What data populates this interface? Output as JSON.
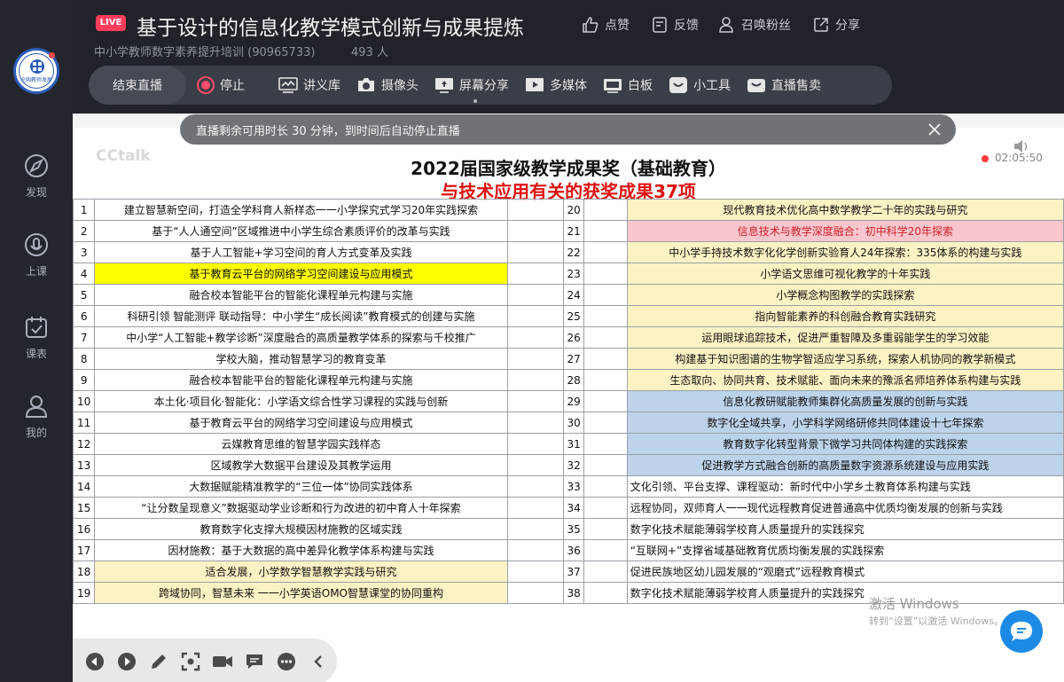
{
  "header": {
    "live_badge": "LIVE",
    "title": "基于设计的信息化教学模式创新与成果提炼",
    "subtitle": "中小学教师数字素养提升培训 (90965733)",
    "viewers": "493 人",
    "actions": {
      "like": "点赞",
      "feedback": "反馈",
      "summon": "召唤粉丝",
      "share": "分享"
    }
  },
  "logo": {
    "text": "全国教师发展"
  },
  "sidebar": {
    "items": [
      {
        "label": "发现",
        "icon": "compass-icon"
      },
      {
        "label": "上课",
        "icon": "microphone-icon"
      },
      {
        "label": "课表",
        "icon": "calendar-check-icon"
      },
      {
        "label": "我的",
        "icon": "user-icon"
      }
    ]
  },
  "toolbar": {
    "end_live": "结束直播",
    "stop": "停止",
    "lecture_library": "讲义库",
    "camera": "摄像头",
    "screen_share": "屏幕分享",
    "multimedia": "多媒体",
    "whiteboard": "白板",
    "tools": "小工具",
    "live_sales": "直播售卖"
  },
  "notice": {
    "text": "直播剩余可用时长 30 分钟，到时间后自动停止直播"
  },
  "recording": {
    "time": "02:05:50"
  },
  "slide": {
    "watermark": "CCtalk",
    "title": "2022届国家级教学成果奖（基础教育）",
    "subtitle": "与技术应用有关的获奖成果37项",
    "rows": [
      {
        "n1": "1",
        "left": "建立智慧新空间，打造全学科育人新样态一一小学探究式学习20年实践探索",
        "n2": "20",
        "right": "现代教育技术优化高中数学教学二十年的实践与研究"
      },
      {
        "n1": "2",
        "left": "基于“人人通空间”区域推进中小学生综合素质评价的改革与实践",
        "n2": "21",
        "right": "信息技术与教学深度融合：初中科学20年探索"
      },
      {
        "n1": "3",
        "left": "基于人工智能+学习空间的育人方式变革及实践",
        "n2": "22",
        "right": "中小学手持技术数字化化学创新实验育人24年探索：335体系的构建与实践"
      },
      {
        "n1": "4",
        "left": "基于教育云平台的网络学习空间建设与应用模式",
        "n2": "23",
        "right": "小学语文思维可视化教学的十年实践"
      },
      {
        "n1": "5",
        "left": "融合校本智能平台的智能化课程单元构建与实施",
        "n2": "24",
        "right": "小学概念构图教学的实践探索"
      },
      {
        "n1": "6",
        "left": "科研引领  智能测评  联动指导：中小学生“成长阅读”教育模式的创建与实施",
        "n2": "25",
        "right": "指向智能素养的科创融合教育实践研究"
      },
      {
        "n1": "7",
        "left": "中小学“人工智能+教学诊断”深度融合的高质量教学体系的探索与千校推广",
        "n2": "26",
        "right": "运用眼球追踪技术，促进严重智障及多重弱能学生的学习效能"
      },
      {
        "n1": "8",
        "left": "学校大脑，推动智慧学习的教育变革",
        "n2": "27",
        "right": "构建基于知识图谱的生物学智适应学习系统，探索人机协同的教学新模式"
      },
      {
        "n1": "9",
        "left": "融合校本智能平台的智能化课程单元构建与实施",
        "n2": "28",
        "right": "生态取向、协同共育、技术赋能、面向未来的豫派名师培养体系构建与实践"
      },
      {
        "n1": "10",
        "left": "本土化·项目化·智能化：小学语文综合性学习课程的实践与创新",
        "n2": "29",
        "right": "信息化教研赋能教师集群化高质量发展的创新与实践"
      },
      {
        "n1": "11",
        "left": "基于教育云平台的网络学习空间建设与应用模式",
        "n2": "30",
        "right": "数字化全域共享，小学科学网络研修共同体建设十七年探索"
      },
      {
        "n1": "12",
        "left": "云媒教育思维的智慧学园实践样态",
        "n2": "31",
        "right": "教育数字化转型背景下微学习共同体构建的实践探索"
      },
      {
        "n1": "13",
        "left": "区域教学大数据平台建设及其教学运用",
        "n2": "32",
        "right": "促进教学方式融合创新的高质量数字资源系统建设与应用实践"
      },
      {
        "n1": "14",
        "left": "大数据赋能精准教学的“三位一体”协同实践体系",
        "n2": "33",
        "right": "文化引领、平台支撑、课程驱动：新时代中小学乡土教育体系构建与实践"
      },
      {
        "n1": "15",
        "left": "“让分数呈现意义”数据驱动学业诊断和行为改进的初中育人十年探索",
        "n2": "34",
        "right": "远程协同，双师育人一一现代远程教育促进普通高中优质均衡发展的创新与实践"
      },
      {
        "n1": "16",
        "left": "教育数字化支撑大规模因材施教的区域实践",
        "n2": "35",
        "right": "数字化技术赋能薄弱学校育人质量提升的实践探究"
      },
      {
        "n1": "17",
        "left": "因材施教：基于大数据的高中差异化教学体系构建与实践",
        "n2": "36",
        "right": "“互联网+”支撑省域基础教育优质均衡发展的实践探索"
      },
      {
        "n1": "18",
        "left": "适合发展，小学数学智慧教学实践与研究",
        "n2": "37",
        "right": "促进民族地区幼儿园发展的“观磨式”远程教育模式"
      },
      {
        "n1": "19",
        "left": "跨域协同，智慧未来  一一小学英语OMO智慧课堂的协同重构",
        "n2": "38",
        "right": "数字化技术赋能薄弱学校育人质量提升的实践探究"
      }
    ],
    "left_highlights": {
      "4": "#ffff00",
      "18": "#fdf2c4",
      "19": "#fdf2c4"
    },
    "right_highlights": {
      "20": "#fdf2c4",
      "21": "#f8c6cc",
      "22": "#fdf2c4",
      "23": "#fdf2c4",
      "24": "#fdf2c4",
      "25": "#fdf2c4",
      "26": "#fdf2c4",
      "27": "#fdf2c4",
      "28": "#fdf2c4",
      "29": "#bcd3ea",
      "30": "#bcd3ea",
      "31": "#bcd3ea",
      "32": "#bcd3ea"
    },
    "right_text_colors": {
      "21": "#d0202a"
    },
    "right_centered": [
      "20",
      "21",
      "22",
      "23",
      "24",
      "25",
      "26",
      "27",
      "28",
      "29",
      "30",
      "31",
      "32"
    ]
  },
  "windows_watermark": {
    "line1": "激活 Windows",
    "line2": "转到“设置”以激活 Windows。"
  },
  "colors": {
    "accent_live": "#ff3d5a",
    "stop_red": "#ff4b6a",
    "chat_blue": "#1d8be6"
  }
}
